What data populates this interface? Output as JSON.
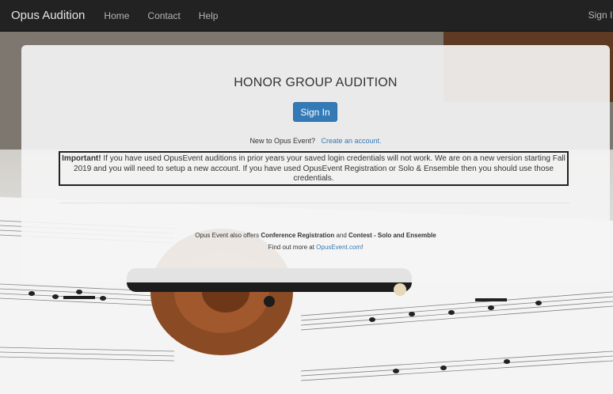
{
  "navbar": {
    "brand": "Opus Audition",
    "links": [
      "Home",
      "Contact",
      "Help"
    ],
    "right": "Sign In"
  },
  "panel": {
    "title": "HONOR GROUP AUDITION",
    "signin_button": "Sign In",
    "new_prompt": "New to Opus Event?",
    "create_link": "Create an account.",
    "notice_strong": "Important!",
    "notice_text": " If you have used OpusEvent auditions in prior years your saved login credentials will not work. We are on a new version starting Fall 2019 and you will need to setup a new account. If you have used OpusEvent Registration or Solo & Ensemble then you should use those credentials.",
    "offers_prefix": "Opus Event also offers ",
    "offers_conf": "Conference Registration",
    "offers_and": " and ",
    "offers_contest": "Contest - Solo and Ensemble",
    "findout_prefix": "Find out more at ",
    "findout_link": "OpusEvent.com",
    "findout_suffix": "!"
  },
  "colors": {
    "navbar": "#222222",
    "primary": "#337ab7",
    "link": "#337ab7"
  }
}
